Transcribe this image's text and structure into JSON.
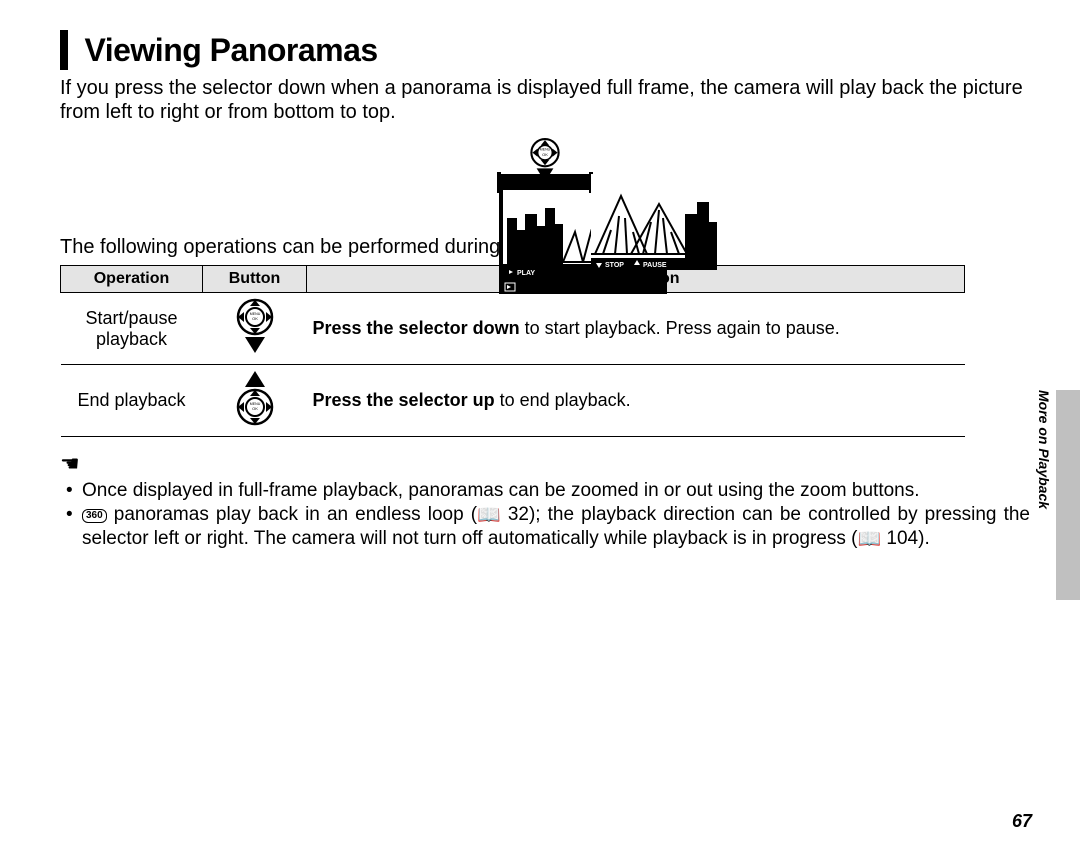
{
  "title": "Viewing Panoramas",
  "intro": "If you press the selector down when a panorama is displayed full frame, the camera will play back the picture from left to right or from bottom to top.",
  "figure": {
    "left_play_label": "PLAY",
    "left_playback_icon": "▶",
    "right_stop_label": "STOP",
    "right_pause_label": "PAUSE"
  },
  "sub_intro": "The following operations can be performed during playback:",
  "table": {
    "headers": {
      "col1": "Operation",
      "col2": "Button",
      "col3": "Description"
    },
    "rows": [
      {
        "op_line1": "Start/pause",
        "op_line2": "playback",
        "desc_bold": "Press the selector down",
        "desc_rest": " to start playback.  Press again to pause.",
        "dir": "down"
      },
      {
        "op_line1": "End playback",
        "op_line2": "",
        "desc_bold": "Press the selector up",
        "desc_rest": " to end playback.",
        "dir": "up"
      }
    ]
  },
  "notes": {
    "note1": "Once displayed in full-frame playback, panoramas can be zoomed in or out using the zoom buttons.",
    "note2_pre": " panoramas play back in an endless loop (",
    "note2_mid": " 32); the playback direction can be controlled by pressing the selector left or right.   The camera will not turn off automatically while playback is in progress (",
    "note2_end": " 104).",
    "pano360_label": "360"
  },
  "sidebar": "More on Playback",
  "page_number": "67"
}
